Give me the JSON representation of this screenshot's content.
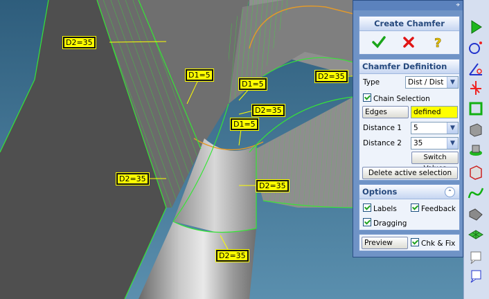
{
  "viewport": {
    "labels": [
      {
        "text": "D2=35",
        "name": "dim-label-d2-top-left"
      },
      {
        "text": "D1=5",
        "name": "dim-label-d1-upper"
      },
      {
        "text": "D1=5",
        "name": "dim-label-d1-center"
      },
      {
        "text": "D2=35",
        "name": "dim-label-d2-right"
      },
      {
        "text": "D2=35",
        "name": "dim-label-d2-center"
      },
      {
        "text": "D1=5",
        "name": "dim-label-d1-lower"
      },
      {
        "text": "D2=35",
        "name": "dim-label-d2-left"
      },
      {
        "text": "D2=35",
        "name": "dim-label-d2-lower-center"
      },
      {
        "text": "D2=35",
        "name": "dim-label-d2-bottom"
      }
    ]
  },
  "panel": {
    "title": "Create Chamfer",
    "definition_header": "Chamfer Definition",
    "type_label": "Type",
    "type_value": "Dist / Dist",
    "chain_selection_label": "Chain Selection",
    "edges_button": "Edges",
    "edges_status": "defined",
    "distance1_label": "Distance 1",
    "distance1_value": "5",
    "distance2_label": "Distance 2",
    "distance2_value": "35",
    "switch_values_button": "Switch Values",
    "delete_button": "Delete active selection",
    "options_header": "Options",
    "labels_option": "Labels",
    "feedback_option": "Feedback",
    "dragging_option": "Dragging",
    "preview_button": "Preview",
    "chk_fix_label": "Chk & Fix"
  },
  "colors": {
    "label_bg": "#ffff00",
    "edge_green": "#36e536",
    "status_yellow": "#ffff00"
  }
}
